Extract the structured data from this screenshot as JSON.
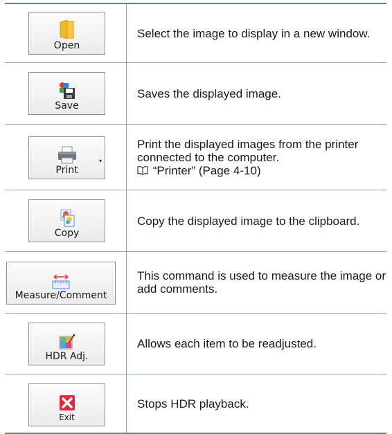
{
  "rows": [
    {
      "button": {
        "label": "Open",
        "icon": "folder-icon"
      },
      "description": "Select the image to display in a new window."
    },
    {
      "button": {
        "label": "Save",
        "icon": "save-icon"
      },
      "description": "Saves the displayed image."
    },
    {
      "button": {
        "label": "Print",
        "icon": "printer-icon",
        "dropdown": "▾"
      },
      "description": "Print the displayed images from the printer connected to the computer.",
      "reference": {
        "glyph": "book-icon",
        "text": "“Printer” (Page 4-10)"
      }
    },
    {
      "button": {
        "label": "Copy",
        "icon": "copy-icon"
      },
      "description": "Copy the displayed image to the clipboard."
    },
    {
      "button": {
        "label": "Measure/Comment",
        "icon": "ruler-icon"
      },
      "description": "This command is used to measure the image or add comments."
    },
    {
      "button": {
        "label": "HDR Adj.",
        "icon": "hdr-adjust-icon"
      },
      "description": "Allows each item to be readjusted."
    },
    {
      "button": {
        "label": "Exit",
        "icon": "exit-icon"
      },
      "description": "Stops HDR playback."
    }
  ],
  "colors": {
    "table_border": "#5f7ea3",
    "row_divider": "#8da3bd",
    "exit_red": "#e0283c",
    "folder": "#f5b323"
  }
}
